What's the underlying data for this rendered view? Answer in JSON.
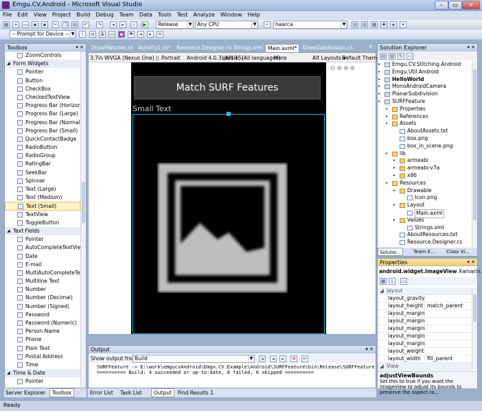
{
  "window": {
    "title": "Emgu.CV.Android - Microsoft Visual Studio",
    "min": "–",
    "max": "▭",
    "close": "✕"
  },
  "menu": [
    "File",
    "Edit",
    "View",
    "Project",
    "Build",
    "Debug",
    "Team",
    "Data",
    "Tools",
    "Test",
    "Analyze",
    "Window",
    "Help"
  ],
  "toolbar": {
    "config": "Release",
    "platform": "Any CPU",
    "find": "haarca",
    "device": "-- Prompt for Device --"
  },
  "toolbox": {
    "title": "Toolbox",
    "pin": "▾ ✕",
    "items": [
      {
        "t": "item",
        "label": "ZoomControls"
      },
      {
        "t": "sec",
        "label": "Form Widgets"
      },
      {
        "t": "item",
        "label": "Pointer"
      },
      {
        "t": "item",
        "label": "Button"
      },
      {
        "t": "item",
        "label": "CheckBox"
      },
      {
        "t": "item",
        "label": "CheckedTextView"
      },
      {
        "t": "item",
        "label": "Progress Bar (Horizont..."
      },
      {
        "t": "item",
        "label": "Progress Bar (Large)"
      },
      {
        "t": "item",
        "label": "Progress Bar (Normal)"
      },
      {
        "t": "item",
        "label": "Progress Bar (Small)"
      },
      {
        "t": "item",
        "label": "QuickContactBadge"
      },
      {
        "t": "item",
        "label": "RadioButton"
      },
      {
        "t": "item",
        "label": "RadioGroup"
      },
      {
        "t": "item",
        "label": "RatingBar"
      },
      {
        "t": "item",
        "label": "SeekBar"
      },
      {
        "t": "item",
        "label": "Spinner"
      },
      {
        "t": "item",
        "label": "Text (Large)"
      },
      {
        "t": "item",
        "label": "Text (Medium)"
      },
      {
        "t": "item",
        "label": "Text (Small)",
        "sel": true
      },
      {
        "t": "item",
        "label": "TextView"
      },
      {
        "t": "item",
        "label": "ToggleButton"
      },
      {
        "t": "sec",
        "label": "Text Fields"
      },
      {
        "t": "item",
        "label": "Pointer"
      },
      {
        "t": "item",
        "label": "AutoCompleteTextView"
      },
      {
        "t": "item",
        "label": "Date"
      },
      {
        "t": "item",
        "label": "E-mail"
      },
      {
        "t": "item",
        "label": "MultiAutoCompleteTe..."
      },
      {
        "t": "item",
        "label": "Multiline Text"
      },
      {
        "t": "item",
        "label": "Number"
      },
      {
        "t": "item",
        "label": "Number (Decimal)"
      },
      {
        "t": "item",
        "label": "Number (Signed)"
      },
      {
        "t": "item",
        "label": "Password"
      },
      {
        "t": "item",
        "label": "Password (Numeric)"
      },
      {
        "t": "item",
        "label": "Person Name"
      },
      {
        "t": "item",
        "label": "Phone"
      },
      {
        "t": "item",
        "label": "Plain Text"
      },
      {
        "t": "item",
        "label": "Postal Address"
      },
      {
        "t": "item",
        "label": "Time"
      },
      {
        "t": "sec",
        "label": "Time & Date"
      },
      {
        "t": "item",
        "label": "Pointer"
      },
      {
        "t": "item",
        "label": "AnalogClock"
      }
    ]
  },
  "bottom_left_tabs": [
    "Server Explorer",
    "Toolbox"
  ],
  "doc_tabs": [
    "DrawMatches.cs",
    "Activity1.cs*",
    "Resource.Designer.cs",
    "Strings.xml",
    "Main.axml*",
    "DrawSubdivision.cs"
  ],
  "designer": {
    "device": "3.7in WVGA (Nexus One)",
    "orientation": "Portrait",
    "api": "Android 4.0.3 (API 15)",
    "locale": "Locale: (All languages)",
    "more": "More",
    "alt_layouts": "Alt Layouts ▾",
    "theme": "Default Theme",
    "button_text": "Match SURF Features",
    "small_text": "Small Text"
  },
  "output": {
    "title": "Output",
    "show_from": "Show output from:",
    "source": "Build",
    "lines": [
      "SURFFeature -> E:\\work\\emgucvAndroid\\Emgu.CV.Example\\Android\\SURFFeature\\bin\\Release\\SURFFeature",
      "========== Build: 4 succeeded or up-to-date, 0 failed, 0 skipped =========="
    ]
  },
  "bottom_tabs": [
    "Error List",
    "Task List",
    "Output",
    "Find Results 1"
  ],
  "solution": {
    "title": "Solution Explorer",
    "items": [
      {
        "label": "Emgu.CV.Stitching.Android",
        "lvl": 0
      },
      {
        "label": "Emgu.Util.Android",
        "lvl": 0
      },
      {
        "label": "HelloWorld",
        "lvl": 0,
        "bold": true
      },
      {
        "label": "MonoAndroidCamera",
        "lvl": 0
      },
      {
        "label": "PlanarSubdivision",
        "lvl": 0
      },
      {
        "label": "SURFFeature",
        "lvl": 0
      },
      {
        "label": "Properties",
        "lvl": 1
      },
      {
        "label": "References",
        "lvl": 1
      },
      {
        "label": "Assets",
        "lvl": 1
      },
      {
        "label": "AboutAssets.txt",
        "lvl": 2
      },
      {
        "label": "box.png",
        "lvl": 2
      },
      {
        "label": "box_in_scene.png",
        "lvl": 2
      },
      {
        "label": "lib",
        "lvl": 1
      },
      {
        "label": "armeabi",
        "lvl": 2
      },
      {
        "label": "armeabi-v7a",
        "lvl": 2
      },
      {
        "label": "x86",
        "lvl": 2
      },
      {
        "label": "Resources",
        "lvl": 1
      },
      {
        "label": "Drawable",
        "lvl": 2
      },
      {
        "label": "Icon.png",
        "lvl": 3
      },
      {
        "label": "Layout",
        "lvl": 2
      },
      {
        "label": "Main.axml",
        "lvl": 3
      },
      {
        "label": "Values",
        "lvl": 2
      },
      {
        "label": "Strings.xml",
        "lvl": 3
      },
      {
        "label": "AboutResources.txt",
        "lvl": 2
      },
      {
        "label": "Resource.Designer.cs",
        "lvl": 2
      }
    ],
    "tabs": [
      "Solutio...",
      "Team E...",
      "Class Vi..."
    ]
  },
  "properties": {
    "title": "Properties",
    "object": "android.widget.ImageView",
    "object_type": "Xamarin.And",
    "category": "layout",
    "rows": [
      {
        "n": "layout_gravity",
        "v": ""
      },
      {
        "n": "layout_height",
        "v": "match_parent"
      },
      {
        "n": "layout_margin",
        "v": ""
      },
      {
        "n": "layout_marginBot",
        "v": ""
      },
      {
        "n": "layout_marginLef",
        "v": ""
      },
      {
        "n": "layout_marginRig",
        "v": ""
      },
      {
        "n": "layout_marginTop",
        "v": ""
      },
      {
        "n": "layout_weight",
        "v": ""
      },
      {
        "n": "layout_width",
        "v": "fill_parent"
      }
    ],
    "category2": "View",
    "desc_title": "adjustViewBounds",
    "desc_text": "Set this to true if you want the ImageView to adjust its bounds to preserve the aspect ra..."
  },
  "status": "Ready"
}
